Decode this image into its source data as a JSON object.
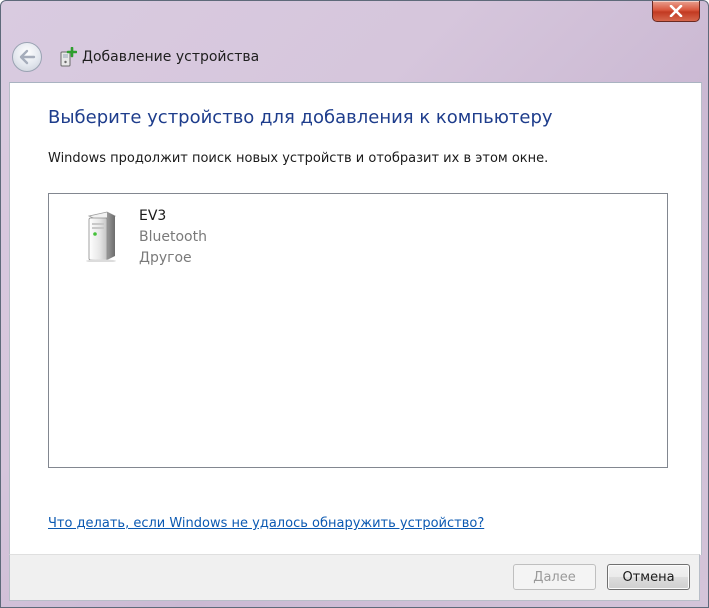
{
  "window": {
    "title": "Добавление устройства"
  },
  "main": {
    "heading": "Выберите устройство для добавления к компьютеру",
    "description": "Windows продолжит поиск новых устройств и отобразит их в этом окне.",
    "devices": [
      {
        "name": "EV3",
        "connection": "Bluetooth",
        "category": "Другое",
        "icon": "computer-tower-icon"
      }
    ],
    "help_link": "Что делать, если Windows не удалось обнаружить устройство?"
  },
  "footer": {
    "next_label": "Далее",
    "cancel_label": "Отмена"
  },
  "colors": {
    "heading": "#1e3d8c",
    "link": "#0b59b2",
    "close_button": "#c8432b"
  }
}
